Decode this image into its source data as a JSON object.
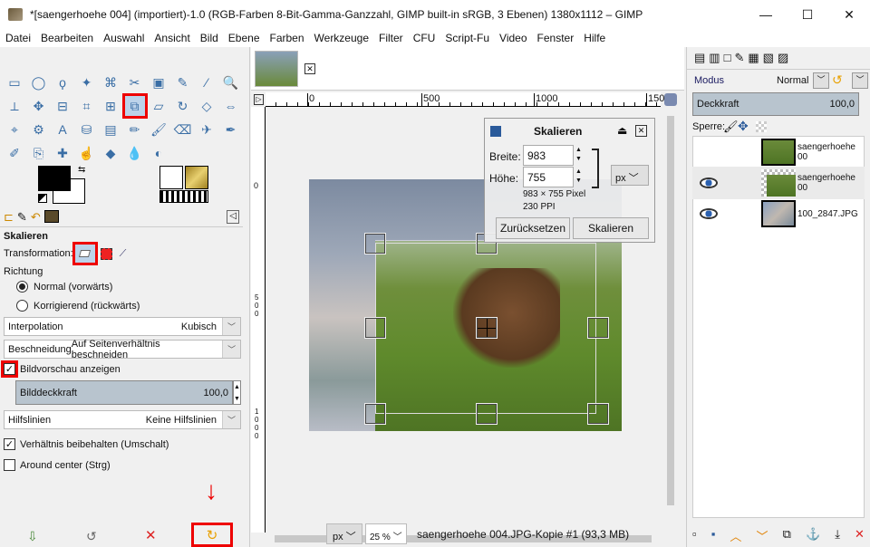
{
  "window": {
    "title": "*[saengerhoehe 004] (importiert)-1.0 (RGB-Farben 8-Bit-Gamma-Ganzzahl, GIMP built-in sRGB, 3 Ebenen) 1380x1112 – GIMP",
    "minimize": "—",
    "maximize": "☐",
    "close": "✕"
  },
  "menu": [
    "Datei",
    "Bearbeiten",
    "Auswahl",
    "Ansicht",
    "Bild",
    "Ebene",
    "Farben",
    "Werkzeuge",
    "Filter",
    "CFU",
    "Script-Fu",
    "Video",
    "Fenster",
    "Hilfe"
  ],
  "toolbox": {
    "tools": [
      "rect-select",
      "ellipse-select",
      "free-select",
      "fuzzy-select",
      "select-by-color",
      "scissors",
      "foreground-select",
      "paths",
      "color-picker",
      "zoom",
      "measure",
      "move",
      "align",
      "crop",
      "unified-transform",
      "scale",
      "shear",
      "rotate",
      "perspective",
      "flip",
      "cage",
      "warp",
      "text",
      "bucket-fill",
      "blend",
      "pencil",
      "paintbrush",
      "eraser",
      "airbrush",
      "ink",
      "mypaint",
      "clone",
      "heal",
      "smudge",
      "dodge",
      "blur",
      "dodge-burn"
    ],
    "tool_glyphs": [
      "▭",
      "◯",
      "ϙ",
      "✦",
      "⌘",
      "✂",
      "▣",
      "✎",
      "⁄",
      "🔍",
      "⟂",
      "✥",
      "⊟",
      "⌗",
      "⊞",
      "⧉",
      "▱",
      "↻",
      "◇",
      "⇔",
      "⌖",
      "⚙",
      "A",
      "⛁",
      "▤",
      "✏",
      "🖌",
      "⌫",
      "✈",
      "✒",
      "✐",
      "⎘",
      "✚",
      "☝",
      "◆",
      "💧",
      "◐"
    ],
    "selected_tool": "scale",
    "fg_color": "#000000",
    "bg_color": "#ffffff"
  },
  "tool_options": {
    "tabs": [
      "tool-options",
      "device-status",
      "undo-history",
      "images"
    ],
    "title": "Skalieren",
    "transformation_label": "Transformation:",
    "direction_label": "Richtung",
    "direction_normal": "Normal (vorwärts)",
    "direction_corrective": "Korrigierend (rückwärts)",
    "interpolation": {
      "label": "Interpolation",
      "value": "Kubisch"
    },
    "clipping": {
      "label": "Beschneidung",
      "value": "Auf Seitenverhältnis beschneiden"
    },
    "show_preview": {
      "label": "Bildvorschau anzeigen",
      "checked": true
    },
    "image_opacity": {
      "label": "Bilddeckkraft",
      "value": "100,0",
      "percent": 100
    },
    "guides": {
      "label": "Hilfslinien",
      "value": "Keine Hilfslinien"
    },
    "keep_aspect": {
      "label": "Verhältnis beibehalten (Umschalt)",
      "checked": true
    },
    "around_center": {
      "label": "Around center (Strg)",
      "checked": false
    }
  },
  "rulers": {
    "h": [
      "0",
      "500",
      "1000",
      "150"
    ],
    "v": [
      "0",
      "5 0 0",
      "1 0 0 0"
    ]
  },
  "scale_dialog": {
    "title": "Skalieren",
    "width_label": "Breite:",
    "width": "983",
    "height_label": "Höhe:",
    "height": "755",
    "unit": "px",
    "size_info": "983 × 755 Pixel",
    "resolution": "230 PPI",
    "reset": "Zurücksetzen",
    "scale": "Skalieren"
  },
  "statusbar": {
    "unit": "px",
    "zoom": "25 %",
    "info": "saengerhoehe 004.JPG-Kopie #1 (93,3 MB)"
  },
  "layers": {
    "mode_label": "Modus",
    "mode": "Normal",
    "opacity_label": "Deckkraft",
    "opacity": "100,0",
    "opacity_percent": 100,
    "lock_label": "Sperre:",
    "items": [
      {
        "name": "saengerhoehe 00",
        "visible": false
      },
      {
        "name": "saengerhoehe 00",
        "visible": true
      },
      {
        "name": "100_2847.JPG",
        "visible": true
      }
    ]
  },
  "annotation_color": "#e00000"
}
